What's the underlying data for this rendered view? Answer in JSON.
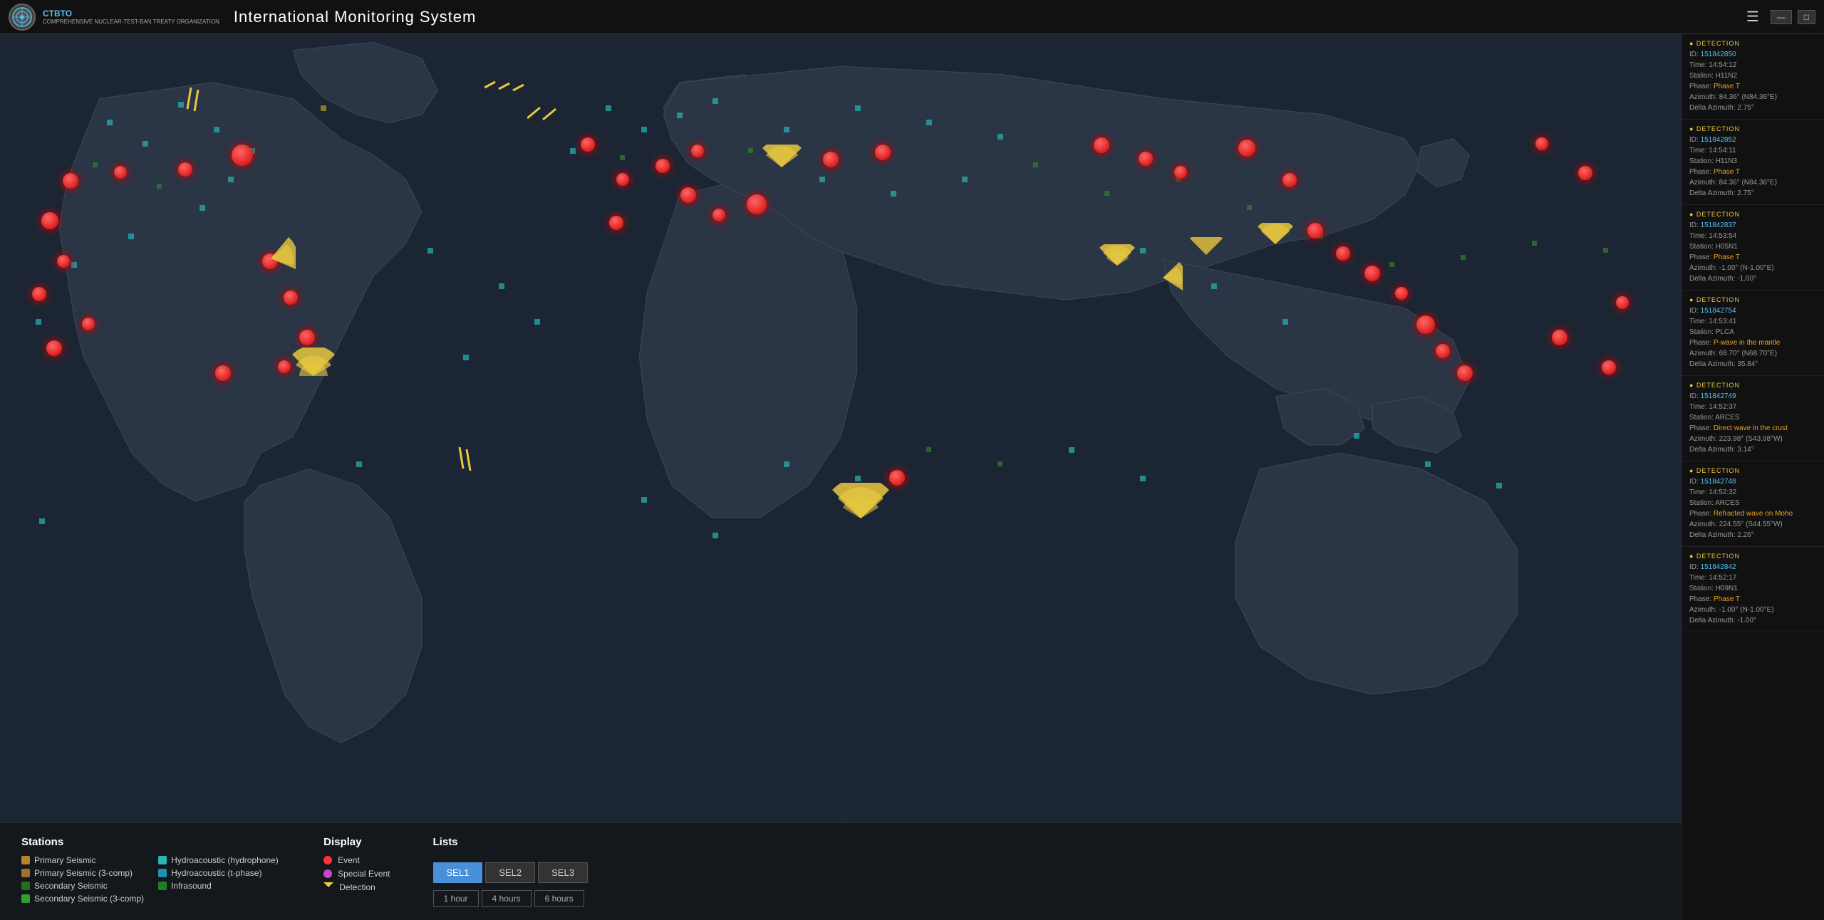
{
  "app": {
    "org_acronym": "CTBTO",
    "org_full_line1": "COMPREHENSIVE",
    "org_full_line2": "NUCLEAR-TEST-BAN",
    "org_full_line3": "TREATY ORGANIZATION",
    "title": "International Monitoring System",
    "hamburger_label": "☰",
    "window_min": "—",
    "window_max": "□"
  },
  "legend": {
    "stations_title": "Stations",
    "display_title": "Display",
    "lists_title": "Lists",
    "station_items": [
      {
        "label": "Primary Seismic",
        "color": "#b5852a"
      },
      {
        "label": "Hydroacoustic (hydrophone)",
        "color": "#2ab5b5"
      },
      {
        "label": "Primary Seismic (3-comp)",
        "color": "#a07030"
      },
      {
        "label": "Hydroacoustic (t-phase)",
        "color": "#2090b5"
      },
      {
        "label": "Secondary Seismic",
        "color": "#207020"
      },
      {
        "label": "Infrasound",
        "color": "#208020"
      },
      {
        "label": "Secondary Seismic (3-comp)",
        "color": "#30a030"
      }
    ],
    "display_items": [
      {
        "label": "Event",
        "color": "#ff3333",
        "type": "circle"
      },
      {
        "label": "Special Event",
        "color": "#cc44cc",
        "type": "circle"
      },
      {
        "label": "Detection",
        "color": "#e8c840",
        "type": "fan"
      }
    ],
    "sel_buttons": [
      {
        "label": "SEL1",
        "active": true
      },
      {
        "label": "SEL2",
        "active": false
      },
      {
        "label": "SEL3",
        "active": false
      }
    ],
    "time_buttons": [
      {
        "label": "1 hour"
      },
      {
        "label": "4 hours"
      },
      {
        "label": "6 hours"
      }
    ]
  },
  "detections": [
    {
      "id": "151842850",
      "time": "14:54:12",
      "station": "H11N2",
      "phase": "Phase T",
      "azimuth": "84.36° (N84.36°E)",
      "delta_azimuth": "2.75°"
    },
    {
      "id": "151842852",
      "time": "14:54:11",
      "station": "H11N3",
      "phase": "Phase T",
      "azimuth": "84.36° (N84.36°E)",
      "delta_azimuth": "2.75°"
    },
    {
      "id": "151842837",
      "time": "14:53:54",
      "station": "H05N1",
      "phase": "Phase T",
      "azimuth": "-1.00° (N-1.00°E)",
      "delta_azimuth": "-1.00°"
    },
    {
      "id": "151842754",
      "time": "14:53:41",
      "station": "PLCA",
      "phase": "P-wave in the mantle",
      "azimuth": "68.70° (N68.70°E)",
      "delta_azimuth": "35.84°"
    },
    {
      "id": "151842749",
      "time": "14:52:37",
      "station": "ARCES",
      "phase": "Direct wave in the crust",
      "azimuth": "223.98° (S43.98°W)",
      "delta_azimuth": "3.14°"
    },
    {
      "id": "151842748",
      "time": "14:52:32",
      "station": "ARCES",
      "phase": "Refracted wave on Moho",
      "azimuth": "224.55° (S44.55°W)",
      "delta_azimuth": "2.26°"
    },
    {
      "id": "151842842",
      "time": "14:52:17",
      "station": "H09N1",
      "phase": "Phase T",
      "azimuth": "-1.00° (N-1.00°E)",
      "delta_azimuth": "-1.00°"
    }
  ],
  "field_labels": {
    "id": "ID: ",
    "time": "Time: ",
    "station": "Station: ",
    "phase": "Phase: ",
    "azimuth": "Azimuth: ",
    "delta_azimuth": "Delta Azimuth: ",
    "detection": "● DETECTION"
  }
}
